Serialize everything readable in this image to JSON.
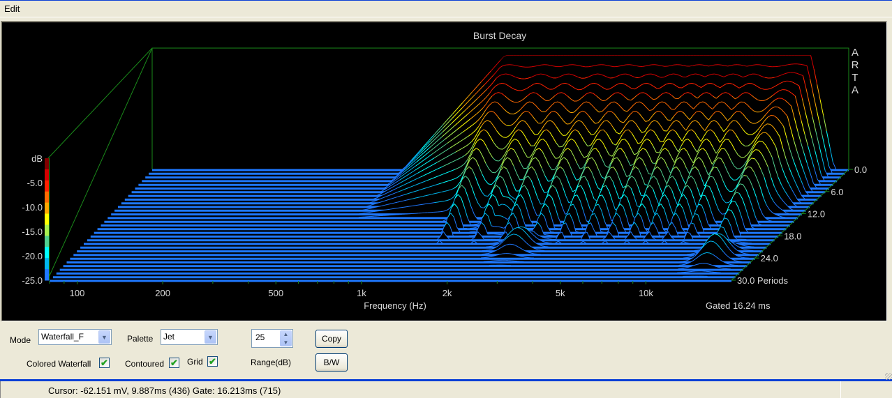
{
  "menu": {
    "items": [
      {
        "label": "Edit"
      }
    ]
  },
  "chart_data": {
    "type": "waterfall3d",
    "title": "Burst Decay",
    "watermark": "ARTA",
    "xlabel": "Frequency (Hz)",
    "x_scale": "log",
    "x_range_hz": [
      80,
      20000
    ],
    "x_ticks": [
      {
        "value": 100,
        "label": "100"
      },
      {
        "value": 200,
        "label": "200"
      },
      {
        "value": 500,
        "label": "500"
      },
      {
        "value": 1000,
        "label": "1k"
      },
      {
        "value": 2000,
        "label": "2k"
      },
      {
        "value": 5000,
        "label": "5k"
      },
      {
        "value": 10000,
        "label": "10k"
      }
    ],
    "x_minor_ticks": [
      80,
      90,
      300,
      400,
      600,
      700,
      800,
      900,
      3000,
      4000,
      6000,
      7000,
      8000,
      9000
    ],
    "zlabel": "dB",
    "z_range_db": [
      -25,
      0
    ],
    "z_ticks": [
      {
        "value": 0,
        "label": "dB"
      },
      {
        "value": -5,
        "label": "-5.0"
      },
      {
        "value": -10,
        "label": "-10.0"
      },
      {
        "value": -15,
        "label": "-15.0"
      },
      {
        "value": -20,
        "label": "-20.0"
      },
      {
        "value": -25,
        "label": "-25.0"
      }
    ],
    "ylabel": "Periods",
    "y_range_periods": [
      0,
      30
    ],
    "y_ticks": [
      {
        "value": 0,
        "label": "0.0"
      },
      {
        "value": 6,
        "label": "6.0"
      },
      {
        "value": 12,
        "label": "12.0"
      },
      {
        "value": 18,
        "label": "18.0"
      },
      {
        "value": 24,
        "label": "24.0"
      },
      {
        "value": 30,
        "label": "30.0 Periods"
      }
    ],
    "gate_label": "Gated 16.24 ms",
    "palette": "Jet",
    "colorbar_colors": [
      "#800000",
      "#d40000",
      "#ff2000",
      "#ff6a00",
      "#ffa800",
      "#ffff00",
      "#a8f050",
      "#50d090",
      "#00ffff",
      "#00b8f0",
      "#1e78ff"
    ],
    "floor_color": "#1e78ff",
    "slices": 31,
    "surface_description": {
      "passband_hz": [
        650,
        17000
      ],
      "passband_level_db": -1.5,
      "ridges_hz": [
        1400,
        1850,
        2300,
        2900,
        3600,
        4400,
        5300,
        6300,
        7300,
        8500,
        10000
      ],
      "late_resonances": [
        {
          "freq_hz": 1500,
          "period": 6,
          "level_db": -19
        },
        {
          "freq_hz": 2000,
          "period": 14,
          "level_db": -20
        },
        {
          "freq_hz": 2700,
          "period": 21,
          "level_db": -21
        },
        {
          "freq_hz": 14500,
          "period": 24,
          "level_db": -20
        }
      ]
    }
  },
  "controls": {
    "mode_label": "Mode",
    "mode_value": "Waterfall_F",
    "palette_label": "Palette",
    "palette_value": "Jet",
    "range_value": "25",
    "range_label": "Range(dB)",
    "copy_label": "Copy",
    "bw_label": "B/W",
    "colored_waterfall_label": "Colored Waterfall",
    "colored_waterfall_checked": true,
    "contoured_label": "Contoured",
    "contoured_checked": true,
    "grid_label": "Grid",
    "grid_checked": true
  },
  "status": {
    "text": "Cursor: -62.151 mV, 9.887ms (436)  Gate: 16.213ms (715)"
  }
}
